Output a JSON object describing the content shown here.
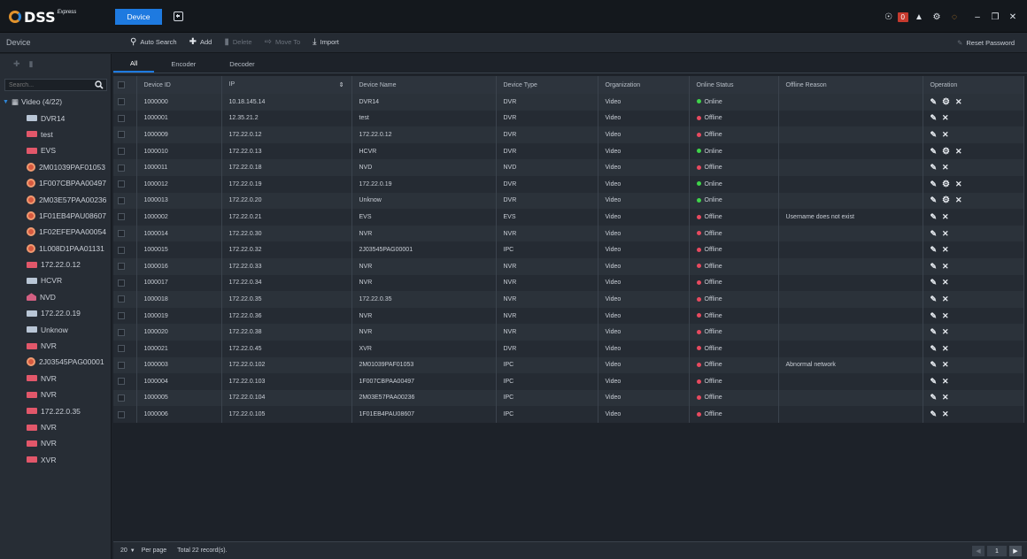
{
  "app": {
    "logo_name": "DSS",
    "logo_sup": "Express",
    "active_tab": "Device",
    "alarm_count": "0"
  },
  "toolbar": {
    "page_label": "Device",
    "auto_search": "Auto Search",
    "add": "Add",
    "delete": "Delete",
    "move_to": "Move To",
    "import": "Import",
    "reset_password": "Reset Password"
  },
  "left": {
    "search_placeholder": "Search...",
    "root_label": "Video (4/22)",
    "items": [
      {
        "label": "DVR14",
        "type": "dvr"
      },
      {
        "label": "test",
        "type": "nvr"
      },
      {
        "label": "EVS",
        "type": "nvr"
      },
      {
        "label": "2M01039PAF01053",
        "type": "ipc"
      },
      {
        "label": "1F007CBPAA00497",
        "type": "ipc"
      },
      {
        "label": "2M03E57PAA00236",
        "type": "ipc"
      },
      {
        "label": "1F01EB4PAU08607",
        "type": "ipc"
      },
      {
        "label": "1F02EFEPAA00054",
        "type": "ipc"
      },
      {
        "label": "1L008D1PAA01131",
        "type": "ipc"
      },
      {
        "label": "172.22.0.12",
        "type": "nvr"
      },
      {
        "label": "HCVR",
        "type": "dvr"
      },
      {
        "label": "NVD",
        "type": "nvd"
      },
      {
        "label": "172.22.0.19",
        "type": "dvr"
      },
      {
        "label": "Unknow",
        "type": "dvr"
      },
      {
        "label": "NVR",
        "type": "nvr"
      },
      {
        "label": "2J03545PAG00001",
        "type": "ipc"
      },
      {
        "label": "NVR",
        "type": "nvr"
      },
      {
        "label": "NVR",
        "type": "nvr"
      },
      {
        "label": "172.22.0.35",
        "type": "nvr"
      },
      {
        "label": "NVR",
        "type": "nvr"
      },
      {
        "label": "NVR",
        "type": "nvr"
      },
      {
        "label": "XVR",
        "type": "nvr"
      }
    ]
  },
  "tabs": [
    "All",
    "Encoder",
    "Decoder"
  ],
  "table": {
    "columns": [
      "Device ID",
      "IP",
      "Device Name",
      "Device Type",
      "Organization",
      "Online Status",
      "Offline Reason",
      "Operation"
    ],
    "rows": [
      {
        "id": "1000000",
        "ip": "10.18.145.14",
        "name": "DVR14",
        "type": "DVR",
        "org": "Video",
        "status": "Online",
        "reason": ""
      },
      {
        "id": "1000001",
        "ip": "12.35.21.2",
        "name": "test",
        "type": "DVR",
        "org": "Video",
        "status": "Offline",
        "reason": ""
      },
      {
        "id": "1000009",
        "ip": "172.22.0.12",
        "name": "172.22.0.12",
        "type": "DVR",
        "org": "Video",
        "status": "Offline",
        "reason": ""
      },
      {
        "id": "1000010",
        "ip": "172.22.0.13",
        "name": "HCVR",
        "type": "DVR",
        "org": "Video",
        "status": "Online",
        "reason": ""
      },
      {
        "id": "1000011",
        "ip": "172.22.0.18",
        "name": "NVD",
        "type": "NVD",
        "org": "Video",
        "status": "Offline",
        "reason": ""
      },
      {
        "id": "1000012",
        "ip": "172.22.0.19",
        "name": "172.22.0.19",
        "type": "DVR",
        "org": "Video",
        "status": "Online",
        "reason": ""
      },
      {
        "id": "1000013",
        "ip": "172.22.0.20",
        "name": "Unknow",
        "type": "DVR",
        "org": "Video",
        "status": "Online",
        "reason": ""
      },
      {
        "id": "1000002",
        "ip": "172.22.0.21",
        "name": "EVS",
        "type": "EVS",
        "org": "Video",
        "status": "Offline",
        "reason": "Username does not exist"
      },
      {
        "id": "1000014",
        "ip": "172.22.0.30",
        "name": "NVR",
        "type": "NVR",
        "org": "Video",
        "status": "Offline",
        "reason": ""
      },
      {
        "id": "1000015",
        "ip": "172.22.0.32",
        "name": "2J03545PAG00001",
        "type": "IPC",
        "org": "Video",
        "status": "Offline",
        "reason": ""
      },
      {
        "id": "1000016",
        "ip": "172.22.0.33",
        "name": "NVR",
        "type": "NVR",
        "org": "Video",
        "status": "Offline",
        "reason": ""
      },
      {
        "id": "1000017",
        "ip": "172.22.0.34",
        "name": "NVR",
        "type": "NVR",
        "org": "Video",
        "status": "Offline",
        "reason": ""
      },
      {
        "id": "1000018",
        "ip": "172.22.0.35",
        "name": "172.22.0.35",
        "type": "NVR",
        "org": "Video",
        "status": "Offline",
        "reason": ""
      },
      {
        "id": "1000019",
        "ip": "172.22.0.36",
        "name": "NVR",
        "type": "NVR",
        "org": "Video",
        "status": "Offline",
        "reason": ""
      },
      {
        "id": "1000020",
        "ip": "172.22.0.38",
        "name": "NVR",
        "type": "NVR",
        "org": "Video",
        "status": "Offline",
        "reason": ""
      },
      {
        "id": "1000021",
        "ip": "172.22.0.45",
        "name": "XVR",
        "type": "DVR",
        "org": "Video",
        "status": "Offline",
        "reason": ""
      },
      {
        "id": "1000003",
        "ip": "172.22.0.102",
        "name": "2M01039PAF01053",
        "type": "IPC",
        "org": "Video",
        "status": "Offline",
        "reason": "Abnormal network"
      },
      {
        "id": "1000004",
        "ip": "172.22.0.103",
        "name": "1F007CBPAA00497",
        "type": "IPC",
        "org": "Video",
        "status": "Offline",
        "reason": ""
      },
      {
        "id": "1000005",
        "ip": "172.22.0.104",
        "name": "2M03E57PAA00236",
        "type": "IPC",
        "org": "Video",
        "status": "Offline",
        "reason": ""
      },
      {
        "id": "1000006",
        "ip": "172.22.0.105",
        "name": "1F01EB4PAU08607",
        "type": "IPC",
        "org": "Video",
        "status": "Offline",
        "reason": ""
      }
    ]
  },
  "footer": {
    "per_page_value": "20",
    "per_page_label": "Per page",
    "total": "Total 22 record(s).",
    "current_page": "1"
  },
  "colors": {
    "accent": "#1e7ae0",
    "online": "#3fd44a",
    "offline": "#e84a5f"
  }
}
